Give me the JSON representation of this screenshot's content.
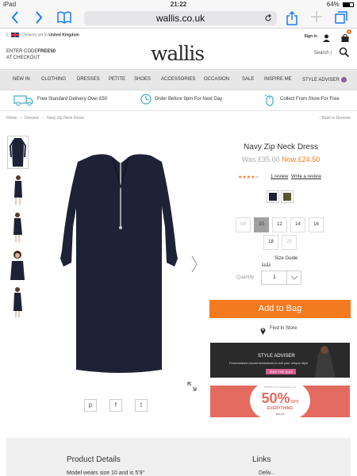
{
  "status_bar": {
    "device": "iPad",
    "time": "21:22",
    "battery": "64%",
    "battery_level": 0.64
  },
  "browser": {
    "url": "wallis.co.uk"
  },
  "header": {
    "delivery_prefix": "Delivery set to",
    "delivery_country": "United Kingdom",
    "promo_line1_prefix": "ENTER CODE",
    "promo_code": "FREE50",
    "promo_line2": "AT CHECKOUT",
    "logo": "wallis",
    "sign_in": "Sign in",
    "bag_count": "0",
    "search_label": "Search |"
  },
  "nav": {
    "items": [
      "NEW IN",
      "CLOTHING",
      "DRESSES",
      "PETITE",
      "SHOES",
      "ACCESSORIES",
      "OCCASION",
      "SALE",
      "INSPIRE ME",
      "STYLE ADVISER"
    ]
  },
  "benefits": [
    "Free Standard Delivery Over £50",
    "Order Before 9pm For Next Day",
    "Collect From Store For Free"
  ],
  "breadcrumb": {
    "items": [
      "Home",
      "Dresses",
      "Navy Zip Neck Dress"
    ],
    "back": "Back to Dresses"
  },
  "product": {
    "title": "Navy Zip Neck Dress",
    "was_price": "Was £35.00",
    "now_price": "Now £24.50",
    "rating": 4,
    "rating_max": 5,
    "reviews_link": "1 review",
    "write_review": "Write a review",
    "colors": [
      "#1d2236",
      "#5b5530"
    ],
    "sizes": [
      {
        "label": "08",
        "state": "disabled"
      },
      {
        "label": "10",
        "state": "selected"
      },
      {
        "label": "12",
        "state": "normal"
      },
      {
        "label": "14",
        "state": "normal"
      },
      {
        "label": "16",
        "state": "normal"
      },
      {
        "label": "18",
        "state": "normal"
      },
      {
        "label": "20",
        "state": "disabled"
      }
    ],
    "size_guide": "Size Guide",
    "quantity_label": "Quantity",
    "quantity": "1",
    "add_to_bag": "Add to Bag",
    "find_in_store": "Find In Store",
    "share": [
      "p",
      "f",
      "t"
    ]
  },
  "promos": {
    "style_title": "STYLE ADVISER",
    "style_sub": "Personalised recommendations to suit your unique style",
    "style_cta": "TAKE THE QUIZ",
    "sale_tag": "SPRING STYLE EVENT",
    "sale_upto": "up to",
    "sale_pct": "50%",
    "sale_off": "OFF",
    "sale_everything": "EVERYTHING",
    "sale_sub": "50% off"
  },
  "footer": {
    "details_heading": "Product Details",
    "details_text": "Model wears size 10 and is 5'9\"",
    "links_heading": "Links",
    "links_first": "Deliv..."
  },
  "colors": {
    "accent": "#f47a1f",
    "ios_blue": "#1a7cf5",
    "nav_bg": "#e7e7e7"
  }
}
